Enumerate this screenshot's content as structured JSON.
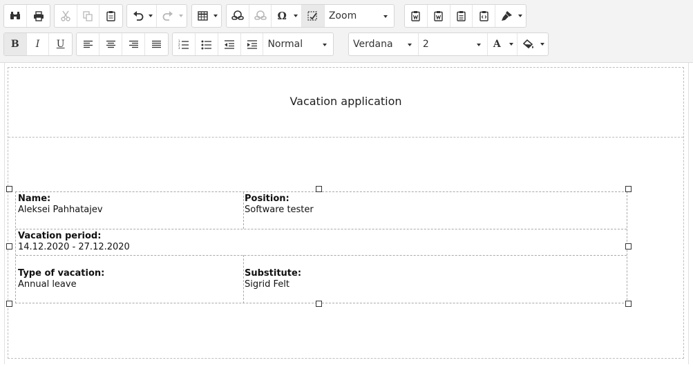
{
  "toolbar": {
    "row1": {
      "find_icon": "binoculars-icon",
      "print_icon": "printer-icon",
      "cut_icon": "scissors-icon",
      "copy_icon": "copy-icon",
      "paste_icon": "clipboard-icon",
      "undo_icon": "undo-icon",
      "redo_icon": "redo-icon",
      "table_icon": "table-icon",
      "link_icon": "link-icon",
      "unlink_icon": "unlink-icon",
      "special_char_label": "Ω",
      "image_icon": "image-edit-icon",
      "zoom_label": "Zoom",
      "paste_word_icon": "paste-word-icon",
      "paste_word2_icon": "paste-word-icon",
      "paste_text_icon": "paste-text-icon",
      "paste_html_icon": "paste-html-icon",
      "format_painter_icon": "brush-icon"
    },
    "row2": {
      "bold_label": "B",
      "italic_label": "I",
      "underline_label": "U",
      "paragraph_format": "Normal",
      "font_name": "Verdana",
      "font_size": "2",
      "font_color_label": "A"
    }
  },
  "document": {
    "title": "Vacation application",
    "fields": [
      {
        "label": "Name:",
        "value": "Aleksei Pahhatajev"
      },
      {
        "label": "Position:",
        "value": "Software tester"
      },
      {
        "label": "Vacation period:",
        "value": "14.12.2020 - 27.12.2020"
      },
      {
        "label": "Type of vacation:",
        "value": "Annual leave"
      },
      {
        "label": "Substitute:",
        "value": "Sigrid Felt"
      }
    ]
  }
}
